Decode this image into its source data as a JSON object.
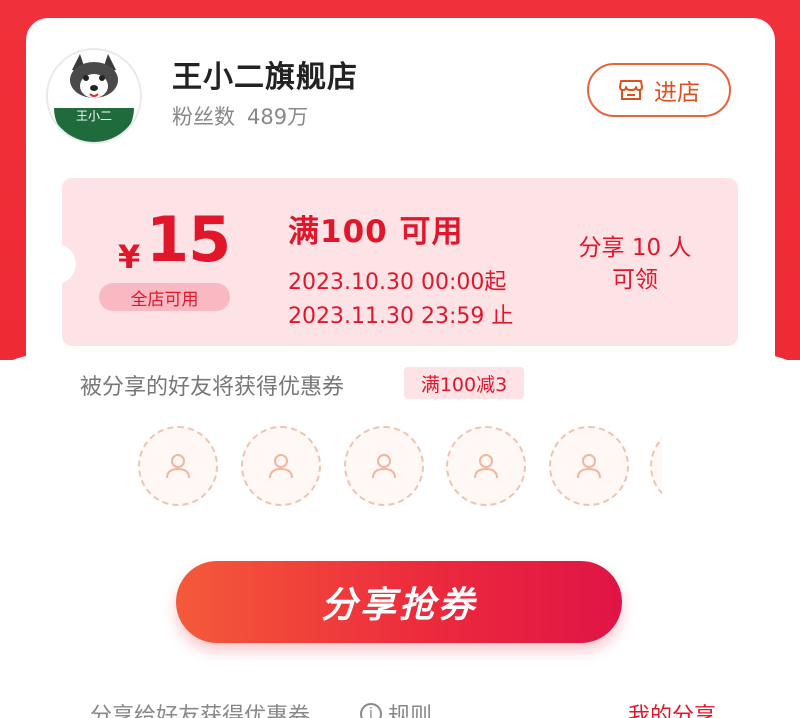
{
  "shop": {
    "name": "王小二旗舰店",
    "fans_label": "粉丝数",
    "fans_count": "489万",
    "enter_label": "进店",
    "logo_text": "王小二"
  },
  "coupon": {
    "currency": "¥",
    "amount": "15",
    "scope": "全店可用",
    "condition": "满100 可用",
    "valid_from": "2023.10.30 00:00起",
    "valid_to": "2023.11.30 23:59 止",
    "share_line1": "分享 10 人",
    "share_line2": "可领"
  },
  "friends": {
    "description": "被分享的好友将获得优惠券",
    "reward_badge": "满100减3"
  },
  "share_button_label": "分享抢券",
  "footer": {
    "text": "分享给好友获得优惠券",
    "rules_label": "规则",
    "my_share_label": "我的分享"
  },
  "colors": {
    "brand_red": "#e0162b",
    "header_red": "#f0303a",
    "coupon_bg": "#fde3e6",
    "enter_orange": "#e8633a"
  }
}
